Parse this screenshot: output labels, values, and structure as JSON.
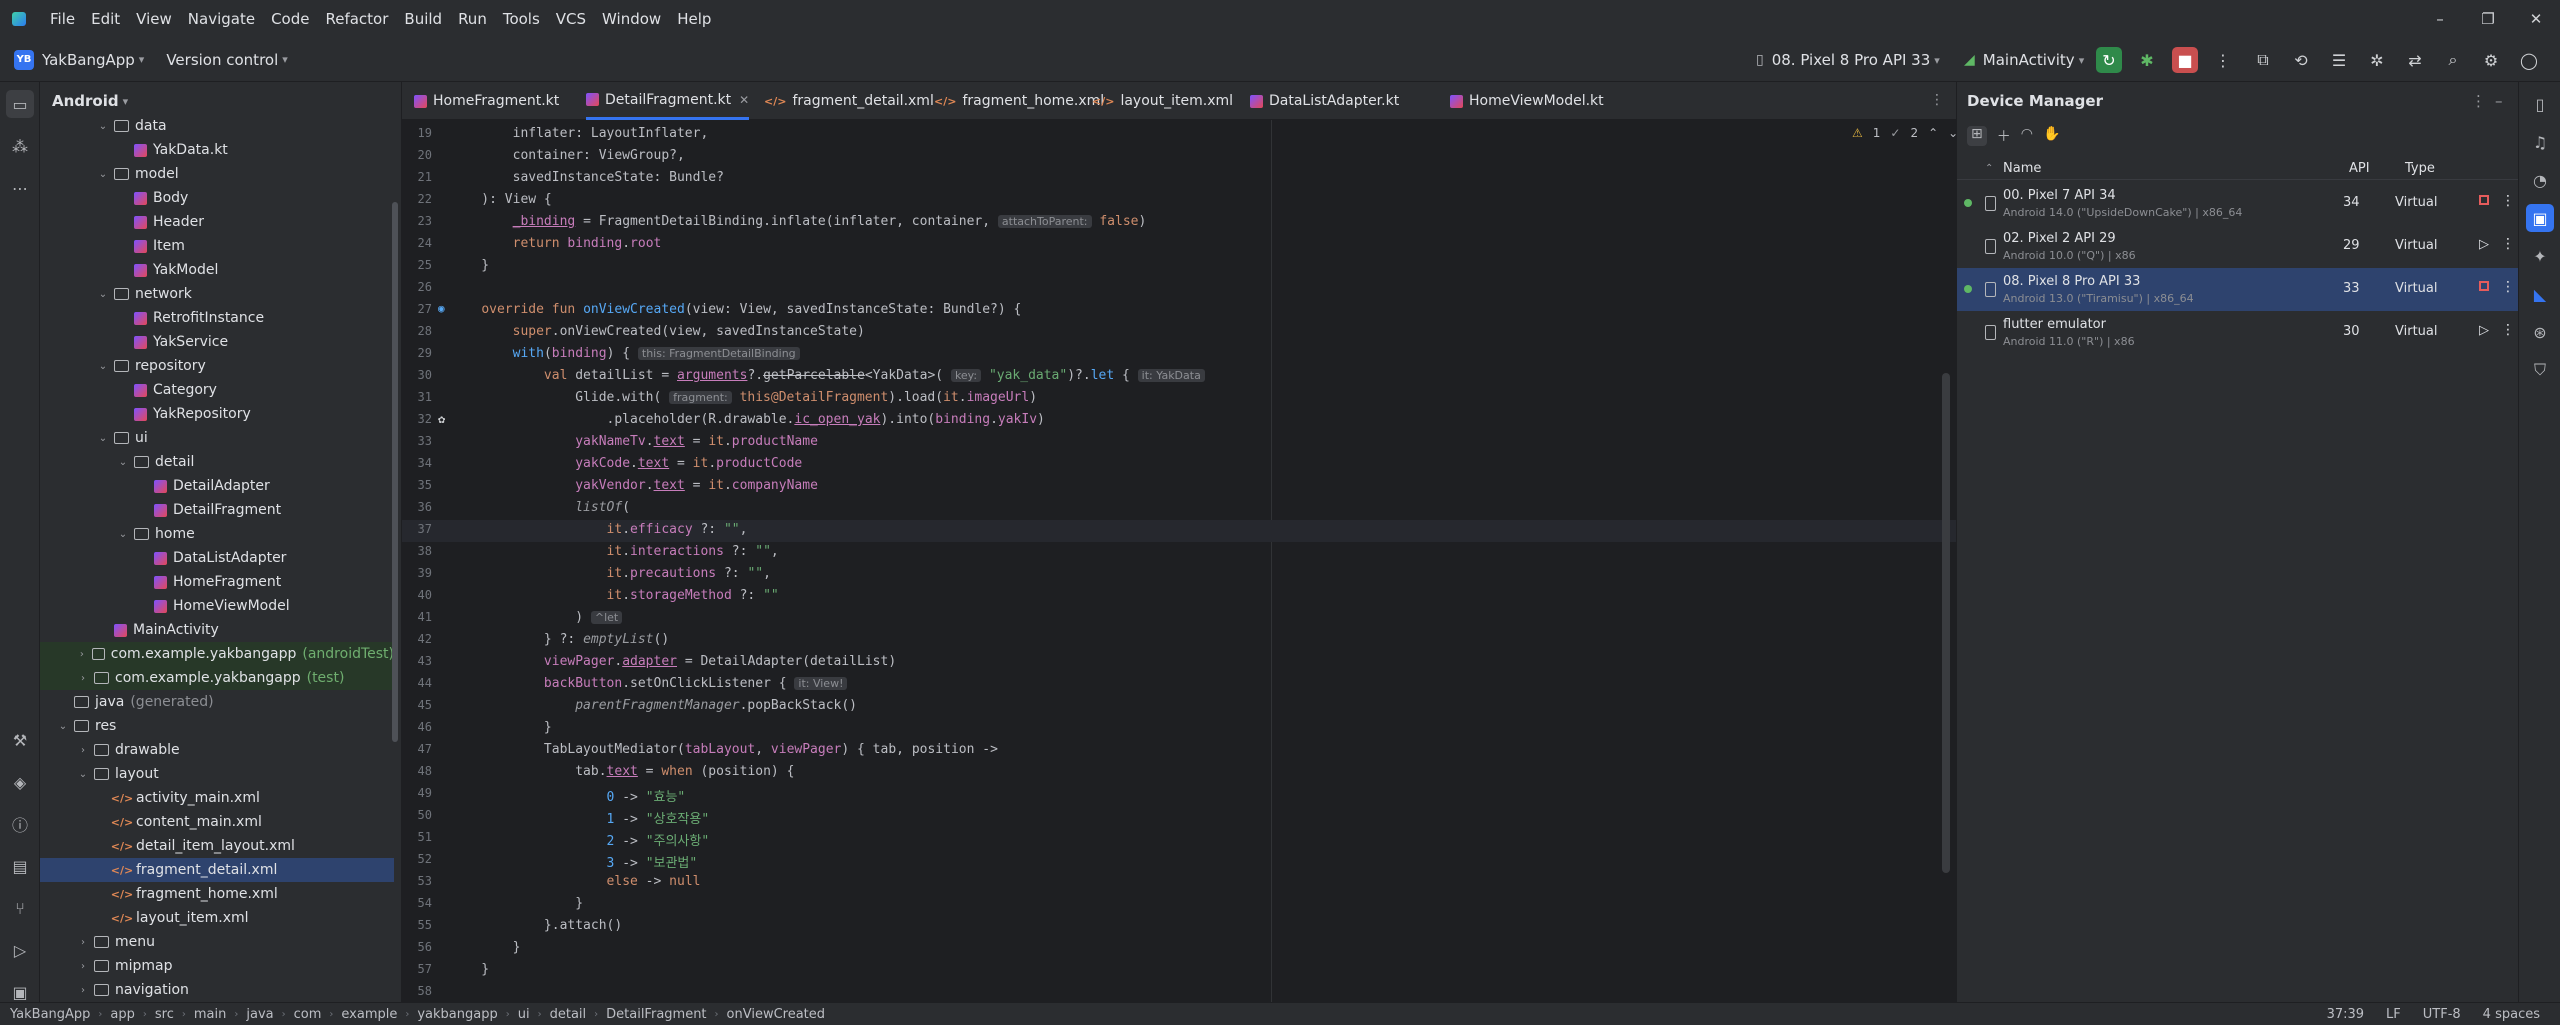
{
  "menubar": {
    "items": [
      "File",
      "Edit",
      "View",
      "Navigate",
      "Code",
      "Refactor",
      "Build",
      "Run",
      "Tools",
      "VCS",
      "Window",
      "Help"
    ]
  },
  "toolbar": {
    "project_badge": "YB",
    "project_name": "YakBangApp",
    "vcs": "Version control",
    "device": "08. Pixel 8 Pro API 33",
    "run_config": "MainActivity"
  },
  "project": {
    "title": "Android",
    "rows": [
      {
        "label": "data",
        "indent": 3,
        "kind": "folder",
        "open": true
      },
      {
        "label": "YakData.kt",
        "indent": 4,
        "kind": "kt"
      },
      {
        "label": "model",
        "indent": 3,
        "kind": "folder",
        "open": true
      },
      {
        "label": "Body",
        "indent": 4,
        "kind": "kt"
      },
      {
        "label": "Header",
        "indent": 4,
        "kind": "kt"
      },
      {
        "label": "Item",
        "indent": 4,
        "kind": "kt"
      },
      {
        "label": "YakModel",
        "indent": 4,
        "kind": "kt"
      },
      {
        "label": "network",
        "indent": 3,
        "kind": "folder",
        "open": true
      },
      {
        "label": "RetrofitInstance",
        "indent": 4,
        "kind": "kt"
      },
      {
        "label": "YakService",
        "indent": 4,
        "kind": "kt"
      },
      {
        "label": "repository",
        "indent": 3,
        "kind": "folder",
        "open": true
      },
      {
        "label": "Category",
        "indent": 4,
        "kind": "kt"
      },
      {
        "label": "YakRepository",
        "indent": 4,
        "kind": "kt"
      },
      {
        "label": "ui",
        "indent": 3,
        "kind": "folder",
        "open": true
      },
      {
        "label": "detail",
        "indent": 4,
        "kind": "folder",
        "open": true
      },
      {
        "label": "DetailAdapter",
        "indent": 5,
        "kind": "kt"
      },
      {
        "label": "DetailFragment",
        "indent": 5,
        "kind": "kt"
      },
      {
        "label": "home",
        "indent": 4,
        "kind": "folder",
        "open": true
      },
      {
        "label": "DataListAdapter",
        "indent": 5,
        "kind": "kt"
      },
      {
        "label": "HomeFragment",
        "indent": 5,
        "kind": "kt"
      },
      {
        "label": "HomeViewModel",
        "indent": 5,
        "kind": "kt"
      },
      {
        "label": "MainActivity",
        "indent": 3,
        "kind": "kt"
      },
      {
        "label": "com.example.yakbangapp",
        "hint": "(androidTest)",
        "indent": 2,
        "kind": "pkg",
        "open": false,
        "green": true
      },
      {
        "label": "com.example.yakbangapp",
        "hint": "(test)",
        "indent": 2,
        "kind": "pkg",
        "open": false,
        "green": true
      },
      {
        "label": "java",
        "gray": "(generated)",
        "indent": 1,
        "kind": "folder",
        "open": null
      },
      {
        "label": "res",
        "indent": 1,
        "kind": "folder",
        "open": true
      },
      {
        "label": "drawable",
        "indent": 2,
        "kind": "folder",
        "open": false
      },
      {
        "label": "layout",
        "indent": 2,
        "kind": "folder",
        "open": true
      },
      {
        "label": "activity_main.xml",
        "indent": 3,
        "kind": "xml"
      },
      {
        "label": "content_main.xml",
        "indent": 3,
        "kind": "xml"
      },
      {
        "label": "detail_item_layout.xml",
        "indent": 3,
        "kind": "xml"
      },
      {
        "label": "fragment_detail.xml",
        "indent": 3,
        "kind": "xml",
        "selected": true
      },
      {
        "label": "fragment_home.xml",
        "indent": 3,
        "kind": "xml"
      },
      {
        "label": "layout_item.xml",
        "indent": 3,
        "kind": "xml"
      },
      {
        "label": "menu",
        "indent": 2,
        "kind": "folder",
        "open": false
      },
      {
        "label": "mipmap",
        "indent": 2,
        "kind": "folder",
        "open": false
      },
      {
        "label": "navigation",
        "indent": 2,
        "kind": "folder",
        "open": false
      }
    ]
  },
  "tabs": [
    {
      "label": "HomeFragment.kt",
      "kind": "kt"
    },
    {
      "label": "DetailFragment.kt",
      "kind": "kt",
      "active": true
    },
    {
      "label": "fragment_detail.xml",
      "kind": "xml"
    },
    {
      "label": "fragment_home.xml",
      "kind": "xml"
    },
    {
      "label": "layout_item.xml",
      "kind": "xml"
    },
    {
      "label": "DataListAdapter.kt",
      "kind": "kt"
    },
    {
      "label": "HomeViewModel.kt",
      "kind": "kt"
    }
  ],
  "editor": {
    "issues": {
      "warnings": "1",
      "weak": "2"
    },
    "current_line": 37,
    "lines": [
      {
        "n": "19",
        "html": "        inflater: LayoutInflater,"
      },
      {
        "n": "20",
        "html": "        container: ViewGroup?,"
      },
      {
        "n": "21",
        "html": "        savedInstanceState: Bundle?"
      },
      {
        "n": "22",
        "html": "    ): View {"
      },
      {
        "n": "23",
        "html": "        <span class=\"prop under\">_binding</span> = FragmentDetailBinding.inflate(inflater, container, <span class=\"hintbox\">attachToParent:</span> <span class=\"kw\">false</span>)"
      },
      {
        "n": "24",
        "html": "        <span class=\"kw\">return</span> <span class=\"prop\">binding</span>.<span class=\"prop\">root</span>"
      },
      {
        "n": "25",
        "html": "    }"
      },
      {
        "n": "26",
        "html": ""
      },
      {
        "n": "27",
        "html": "    <span class=\"kw\">override fun</span> <span class=\"fn\">onViewCreated</span>(view: View, savedInstanceState: Bundle?) {"
      },
      {
        "n": "28",
        "html": "        <span class=\"kw\">super</span>.onViewCreated(view, savedInstanceState)"
      },
      {
        "n": "29",
        "html": "        <span class=\"fn\">with</span>(<span class=\"prop\">binding</span>) { <span class=\"hintbox\">this: FragmentDetailBinding</span>"
      },
      {
        "n": "30",
        "html": "            <span class=\"kw\">val</span> detailList = <span class=\"prop under\">arguments</span>?.<span class=\"strike\">getParcelable</span>&lt;YakData&gt;( <span class=\"hintbox\">key:</span> <span class=\"str\">\"yak_data\"</span>)?.<span class=\"fn\">let</span> { <span class=\"hintbox\">it: YakData</span>"
      },
      {
        "n": "31",
        "html": "                Glide.with( <span class=\"hintbox\">fragment:</span> <span class=\"kw\">this</span><span class=\"kw\">@DetailFragment</span>).load(<span class=\"kw\">it</span>.<span class=\"prop\">imageUrl</span>)"
      },
      {
        "n": "32",
        "html": "                    .placeholder(R.drawable.<span class=\"prop under\">ic_open_yak</span>).into(<span class=\"prop\">binding</span>.<span class=\"prop\">yakIv</span>)"
      },
      {
        "n": "33",
        "html": "                <span class=\"prop\">yakNameTv</span>.<span class=\"prop under\">text</span> = <span class=\"kw\">it</span>.<span class=\"prop\">productName</span>"
      },
      {
        "n": "34",
        "html": "                <span class=\"prop\">yakCode</span>.<span class=\"prop under\">text</span> = <span class=\"kw\">it</span>.<span class=\"prop\">productCode</span>"
      },
      {
        "n": "35",
        "html": "                <span class=\"prop\">yakVendor</span>.<span class=\"prop under\">text</span> = <span class=\"kw\">it</span>.<span class=\"prop\">companyName</span>"
      },
      {
        "n": "36",
        "html": "                <span class=\"it\">listOf</span>("
      },
      {
        "n": "37",
        "html": "                    <span class=\"kw\">it</span>.<span class=\"prop\">efficacy</span> ?: <span class=\"str\">\"\"</span>,"
      },
      {
        "n": "38",
        "html": "                    <span class=\"kw\">it</span>.<span class=\"prop\">interactions</span> ?: <span class=\"str\">\"\"</span>,"
      },
      {
        "n": "39",
        "html": "                    <span class=\"kw\">it</span>.<span class=\"prop\">precautions</span> ?: <span class=\"str\">\"\"</span>,"
      },
      {
        "n": "40",
        "html": "                    <span class=\"kw\">it</span>.<span class=\"prop\">storageMethod</span> ?: <span class=\"str\">\"\"</span>"
      },
      {
        "n": "41",
        "html": "                ) <span class=\"hintbox\">^let</span>"
      },
      {
        "n": "42",
        "html": "            } ?: <span class=\"it\">emptyList</span>()"
      },
      {
        "n": "43",
        "html": "            <span class=\"prop\">viewPager</span>.<span class=\"prop under\">adapter</span> = DetailAdapter(detailList)"
      },
      {
        "n": "44",
        "html": "            <span class=\"prop\">backButton</span>.setOnClickListener { <span class=\"hintbox\">it: View!</span>"
      },
      {
        "n": "45",
        "html": "                <span class=\"prop it\">parentFragmentManager</span>.popBackStack()"
      },
      {
        "n": "46",
        "html": "            }"
      },
      {
        "n": "47",
        "html": "            TabLayoutMediator(<span class=\"prop\">tabLayout</span>, <span class=\"prop\">viewPager</span>) { tab, position -&gt;"
      },
      {
        "n": "48",
        "html": "                tab.<span class=\"prop under\">text</span> = <span class=\"kw\">when</span> (position) {"
      },
      {
        "n": "49",
        "html": "                    <span class=\"fn\">0</span> -&gt; <span class=\"str\">\"효능\"</span>"
      },
      {
        "n": "50",
        "html": "                    <span class=\"fn\">1</span> -&gt; <span class=\"str\">\"상호작용\"</span>"
      },
      {
        "n": "51",
        "html": "                    <span class=\"fn\">2</span> -&gt; <span class=\"str\">\"주의사항\"</span>"
      },
      {
        "n": "52",
        "html": "                    <span class=\"fn\">3</span> -&gt; <span class=\"str\">\"보관법\"</span>"
      },
      {
        "n": "53",
        "html": "                    <span class=\"kw\">else</span> -&gt; <span class=\"kw\">null</span>"
      },
      {
        "n": "54",
        "html": "                }"
      },
      {
        "n": "55",
        "html": "            }.attach()"
      },
      {
        "n": "56",
        "html": "        }"
      },
      {
        "n": "57",
        "html": "    }"
      },
      {
        "n": "58",
        "html": ""
      }
    ]
  },
  "device_manager": {
    "title": "Device Manager",
    "columns": {
      "name": "Name",
      "api": "API",
      "type": "Type"
    },
    "devices": [
      {
        "name": "00. Pixel 7 API 34",
        "sub": "Android 14.0 (\"UpsideDownCake\") | x86_64",
        "api": "34",
        "type": "Virtual",
        "running": true,
        "action": "stop"
      },
      {
        "name": "02. Pixel 2 API 29",
        "sub": "Android 10.0 (\"Q\") | x86",
        "api": "29",
        "type": "Virtual",
        "running": false,
        "action": "play"
      },
      {
        "name": "08. Pixel 8 Pro API 33",
        "sub": "Android 13.0 (\"Tiramisu\") | x86_64",
        "api": "33",
        "type": "Virtual",
        "running": true,
        "action": "stop",
        "selected": true
      },
      {
        "name": "flutter emulator",
        "sub": "Android 11.0 (\"R\") | x86",
        "api": "30",
        "type": "Virtual",
        "running": false,
        "action": "play"
      }
    ]
  },
  "statusbar": {
    "crumbs": [
      "YakBangApp",
      "app",
      "src",
      "main",
      "java",
      "com",
      "example",
      "yakbangapp",
      "ui",
      "detail",
      "DetailFragment",
      "onViewCreated"
    ],
    "position": "37:39",
    "line_sep": "LF",
    "encoding": "UTF-8",
    "indent": "4 spaces"
  }
}
